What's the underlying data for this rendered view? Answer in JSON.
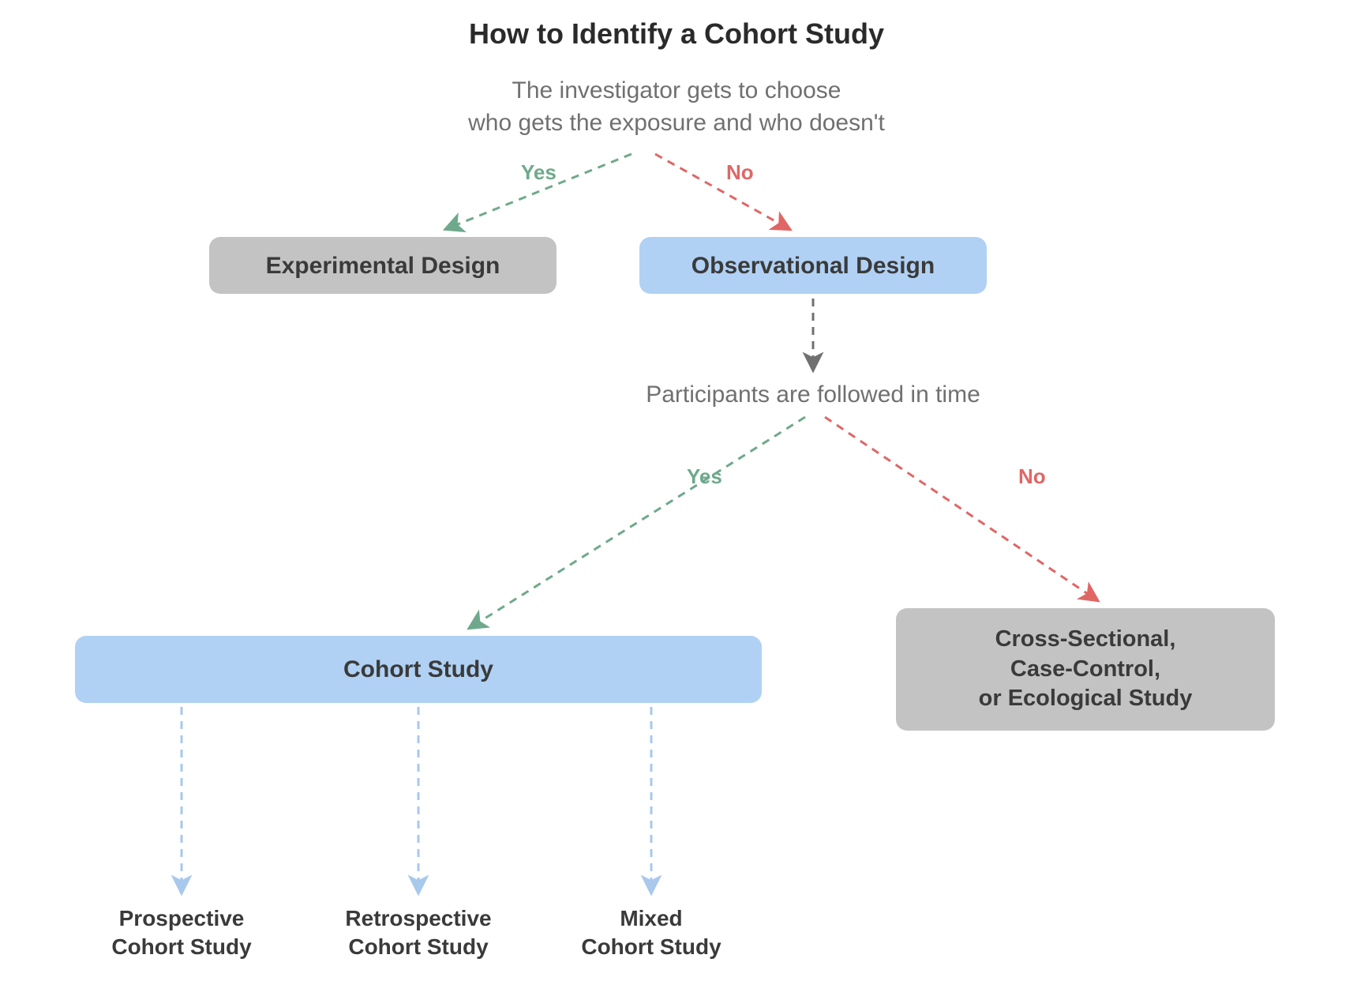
{
  "title": "How to Identify a Cohort Study",
  "q1_line1": "The investigator gets to choose",
  "q1_line2": "who gets the exposure and who doesn't",
  "yes": "Yes",
  "no": "No",
  "experimental": "Experimental Design",
  "observational": "Observational Design",
  "q2": "Participants are followed in time",
  "cohort": "Cohort Study",
  "cross_line1": "Cross-Sectional,",
  "cross_line2": "Case-Control,",
  "cross_line3": "or Ecological Study",
  "leaf1_line1": "Prospective",
  "leaf1_line2": "Cohort Study",
  "leaf2_line1": "Retrospective",
  "leaf2_line2": "Cohort Study",
  "leaf3_line1": "Mixed",
  "leaf3_line2": "Cohort Study",
  "colors": {
    "green": "#6fa98b",
    "red": "#e06666",
    "grey": "#707070",
    "lightblue": "#a8c8ec"
  }
}
